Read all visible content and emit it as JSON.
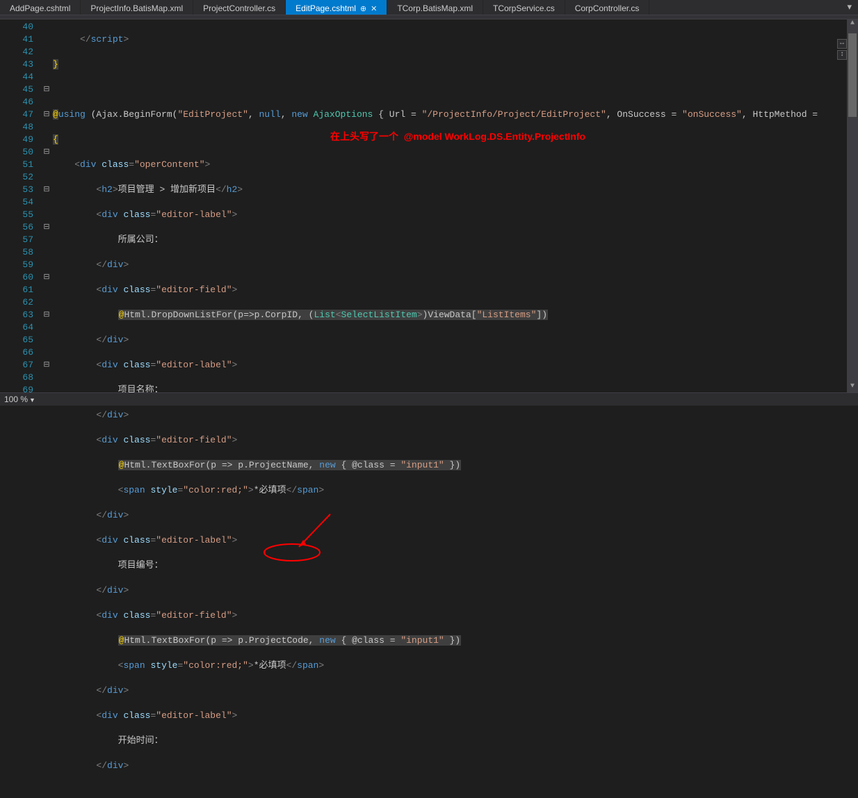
{
  "tabs": [
    {
      "label": "AddPage.cshtml"
    },
    {
      "label": "ProjectInfo.BatisMap.xml"
    },
    {
      "label": "ProjectController.cs"
    },
    {
      "label": "EditPage.cshtml",
      "active": true
    },
    {
      "label": "TCorp.BatisMap.xml"
    },
    {
      "label": "TCorpService.cs"
    },
    {
      "label": "CorpController.cs"
    }
  ],
  "line_start": 40,
  "line_end": 69,
  "fold_markers": {
    "45": "⊟",
    "47": "⊟",
    "50": "⊟",
    "53": "⊟",
    "56": "⊟",
    "60": "⊟",
    "63": "⊟",
    "67": "⊟"
  },
  "code": {
    "l40": {
      "a": "</",
      "b": "script",
      "c": ">"
    },
    "l41": {
      "a": "}"
    },
    "l43": {
      "at": "@",
      "kw": "using",
      "open": " (Ajax.BeginForm(",
      "s1": "\"EditProject\"",
      "c1": ", ",
      "n": "null",
      "c2": ", ",
      "new": "new",
      "sp": " ",
      "ty": "AjaxOptions",
      "br": " { Url = ",
      "s2": "\"/ProjectInfo/Project/EditProject\"",
      "c3": ", OnSuccess = ",
      "s3": "\"onSuccess\"",
      "c4": ", HttpMethod = "
    },
    "l44": {
      "a": "{"
    },
    "l45": {
      "open": "<",
      "tag": "div",
      "sp": " ",
      "attr": "class",
      "eq": "=",
      "val": "\"operContent\"",
      "close": ">"
    },
    "l46": {
      "open1": "<",
      "tag1": "h2",
      "close1": ">",
      "txt": "项目管理 > 增加新项目",
      "open2": "</",
      "tag2": "h2",
      "close2": ">"
    },
    "l47": {
      "open": "<",
      "tag": "div",
      "sp": " ",
      "attr": "class",
      "eq": "=",
      "val": "\"editor-label\"",
      "close": ">"
    },
    "l48": {
      "txt": "所属公司："
    },
    "l49": {
      "open": "</",
      "tag": "div",
      "close": ">"
    },
    "l50": {
      "open": "<",
      "tag": "div",
      "sp": " ",
      "attr": "class",
      "eq": "=",
      "val": "\"editor-field\"",
      "close": ">"
    },
    "l51": {
      "at": "@",
      "a": "Html.DropDownListFor(p=>p.CorpID, (",
      "ty1": "List",
      "lt": "<",
      "ty2": "SelectListItem",
      "gt": ">",
      "b": ")ViewData[",
      "s": "\"ListItems\"",
      "c": "])"
    },
    "l52": {
      "open": "</",
      "tag": "div",
      "close": ">"
    },
    "l53": {
      "open": "<",
      "tag": "div",
      "sp": " ",
      "attr": "class",
      "eq": "=",
      "val": "\"editor-label\"",
      "close": ">"
    },
    "l54": {
      "txt": "项目名称："
    },
    "l55": {
      "open": "</",
      "tag": "div",
      "close": ">"
    },
    "l56": {
      "open": "<",
      "tag": "div",
      "sp": " ",
      "attr": "class",
      "eq": "=",
      "val": "\"editor-field\"",
      "close": ">"
    },
    "l57": {
      "at": "@",
      "a": "Html.TextBoxFor(p => p.ProjectName, ",
      "new": "new",
      "b": " { @class = ",
      "s": "\"input1\"",
      "c": " })"
    },
    "l58": {
      "open": "<",
      "tag": "span",
      "sp": " ",
      "attr": "style",
      "eq": "=",
      "val": "\"color:red;\"",
      "close": ">",
      "txt": "*必填项",
      "open2": "</",
      "tag2": "span",
      "close2": ">"
    },
    "l59": {
      "open": "</",
      "tag": "div",
      "close": ">"
    },
    "l60": {
      "open": "<",
      "tag": "div",
      "sp": " ",
      "attr": "class",
      "eq": "=",
      "val": "\"editor-label\"",
      "close": ">"
    },
    "l61": {
      "txt": "项目编号："
    },
    "l62": {
      "open": "</",
      "tag": "div",
      "close": ">"
    },
    "l63": {
      "open": "<",
      "tag": "div",
      "sp": " ",
      "attr": "class",
      "eq": "=",
      "val": "\"editor-field\"",
      "close": ">"
    },
    "l64": {
      "at": "@",
      "a": "Html.TextBoxFor(p => p.ProjectCode, ",
      "new": "new",
      "b": " { @class = ",
      "s": "\"input1\"",
      "c": " })"
    },
    "l65": {
      "open": "<",
      "tag": "span",
      "sp": " ",
      "attr": "style",
      "eq": "=",
      "val": "\"color:red;\"",
      "close": ">",
      "txt": "*必填项",
      "open2": "</",
      "tag2": "span",
      "close2": ">"
    },
    "l66": {
      "open": "</",
      "tag": "div",
      "close": ">"
    },
    "l67": {
      "open": "<",
      "tag": "div",
      "sp": " ",
      "attr": "class",
      "eq": "=",
      "val": "\"editor-label\"",
      "close": ">"
    },
    "l68": {
      "txt": "开始时间："
    },
    "l69": {
      "open": "</",
      "tag": "div",
      "close": ">"
    }
  },
  "annotation": {
    "text1": "在上头写了一个",
    "text2": "@model WorkLog.DS.Entity.ProjectInfo"
  },
  "status": {
    "zoom": "100 %"
  }
}
